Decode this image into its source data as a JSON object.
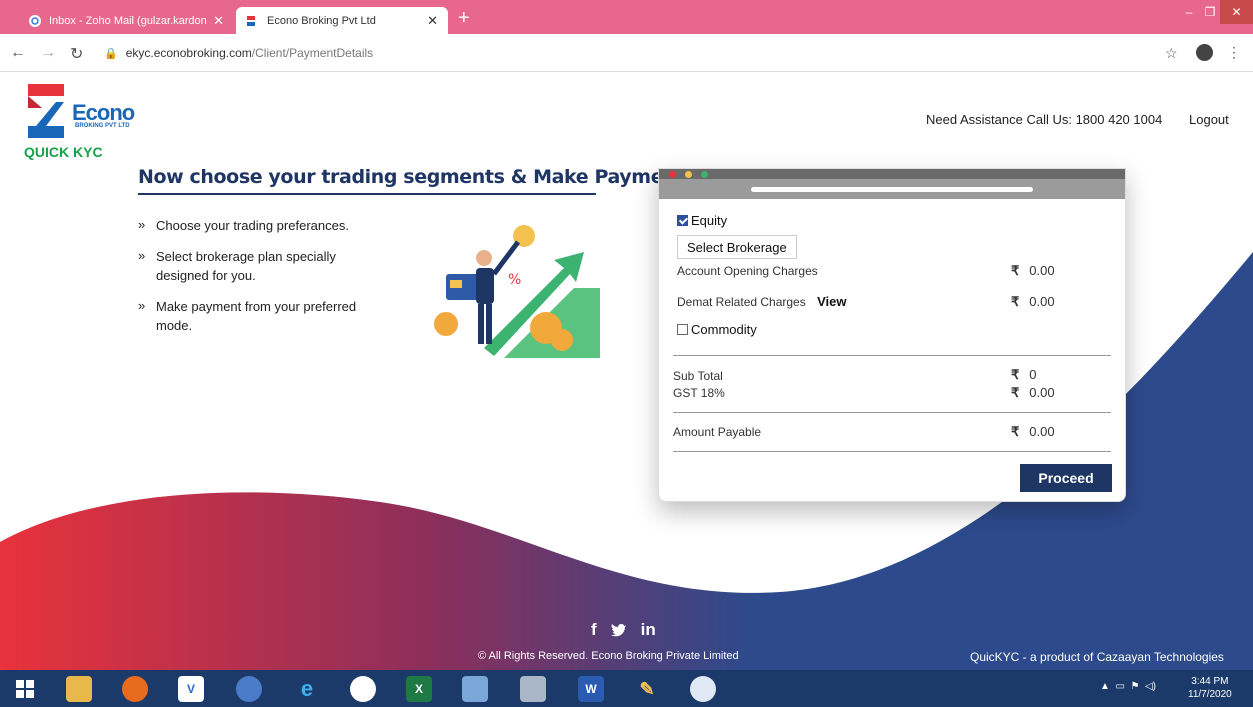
{
  "browser": {
    "tabs": [
      {
        "title": "Inbox - Zoho Mail (gulzar.kardon",
        "active": false
      },
      {
        "title": "Econo Broking Pvt Ltd",
        "active": true
      }
    ],
    "new_tab": "+",
    "url_host": "ekyc.econobroking.com",
    "url_path": "/Client/PaymentDetails"
  },
  "header": {
    "logo_text": "Econo",
    "logo_sub": "BROKING PVT LTD",
    "logo_kyc": "QUICK KYC",
    "assistance": "Need Assistance Call Us: 1800 420 1004",
    "logout": "Logout"
  },
  "main": {
    "heading": "Now choose your trading segments & Make Payment",
    "bullets": [
      "Choose your trading preferances.",
      "Select brokerage plan specially designed for you.",
      "Make payment from your preferred mode."
    ]
  },
  "card": {
    "equity_label": "Equity",
    "equity_checked": true,
    "select_brokerage": "Select Brokerage",
    "account_opening_label": "Account Opening Charges",
    "account_opening_value": "0.00",
    "demat_label": "Demat Related Charges",
    "demat_view": "View",
    "demat_value": "0.00",
    "commodity_label": "Commodity",
    "commodity_checked": false,
    "subtotal_label": "Sub Total",
    "subtotal_value": "0",
    "gst_label": "GST 18%",
    "gst_value": "0.00",
    "amount_label": "Amount Payable",
    "amount_value": "0.00",
    "currency": "₹",
    "proceed": "Proceed"
  },
  "footer": {
    "social": [
      "f",
      "in"
    ],
    "copyright": "© All Rights Reserved. Econo Broking Private Limited",
    "brand": "QuicKYC - a product of Cazaayan Technologies"
  },
  "taskbar": {
    "time": "3:44 PM",
    "date": "11/7/2020"
  },
  "colors": {
    "tabbar": "#e8678f",
    "navy": "#1f3564",
    "wave_red": "#e8323c",
    "wave_blue": "#2d4a8c",
    "green": "#17a24a"
  }
}
